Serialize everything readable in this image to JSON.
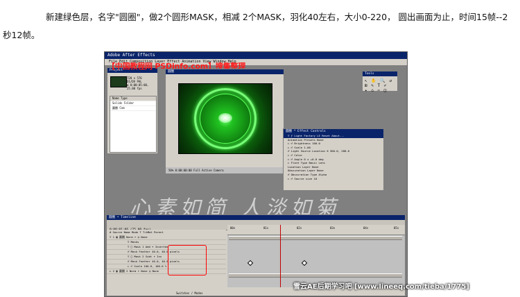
{
  "article": {
    "paragraph": "新建绿色层，名字\"圆圈\"，做2个圆形MASK，相减 2个MASK，羽化40左右，大小0-220， 圆出画面为止，时间15帧--2秒12帧。"
  },
  "screenshot": {
    "window_title": "Adobe After Effects",
    "menu": "File  Edit  Composition  Layer  Effect  Animation  View  Window  Help",
    "watermark_top": "【中国教程网 PSDinfo.com】搜集整理",
    "watermark_calligraphy": "心素如简 人淡如菊",
    "watermark_bottom": "雪云AE后期学习吧 [www.lineeq.com/tieba/1775]",
    "project": {
      "title": "Project",
      "info": [
        "720 x 576",
        "D1/DV PAL",
        "Δ 0:00:05:00, 25.00 fps"
      ],
      "header": "Name                Type",
      "rows": [
        "Solids              Folder",
        "圆圈                Com"
      ]
    },
    "composition": {
      "title": "圆圈",
      "footer": "50%  0:00:00:00   Full   Active Camera"
    },
    "tools": {
      "title": "Tools",
      "glyphs": "↖ ✋ 🔍 ↺\n⊞ ✎ T ✐\n✦ ⌂ ✂ ◫"
    },
    "effect_controls": {
      "title": "圆圈 * Effect Controls",
      "rows": [
        "▽ ƒ Light Factory LE     Reset    About...",
        "  Animation Presets        None",
        "  ▷ ♂ Brightness          100.0",
        "  ▷ ♂ Scale               1.00",
        "  ♂ Light Source Location  ⊕ 360.0, 288.0",
        "  ▷ ♂ Color",
        "  ▷ ♂ Angle               0 x +0.0 deg",
        "  ▷ Flare Type            Basic Lens",
        "  Location Layer          None",
        "  Obscuration Layer       None",
        "  ♂ Obscuration Type      Alpha",
        "  ▷ ♂ Source size         10"
      ]
    },
    "timeline": {
      "title": "圆圈 • Timeline",
      "time": "0:00:01:06 (25.00 fps)",
      "columns": "# Source Name    Mode  T TrkMat   Parent",
      "layers": [
        "▽ 1 ▣ 圆圈        Norm  ▾      ◎ None",
        "  ▽ Masks",
        "    ▽ □ Mask 1     Add  ▾ Inverted",
        "       ♂ Mask Feather  40.0, 40.0 pixels",
        "    ▽ □ Mask 2     Subt ▾ Inv",
        "       ♂ Mask Feather  40.0, 40.0 pixels",
        "  ▷ ♂ Scale        100.0, 100.0 %",
        "▷ 2 ▣ 圆圈 2       Norm  ▾ None  ◎ None"
      ],
      "ruler_ticks": [
        "00s",
        "01s",
        "02s",
        "03s",
        "04s",
        "05s"
      ],
      "footer": "Switches / Modes"
    }
  }
}
